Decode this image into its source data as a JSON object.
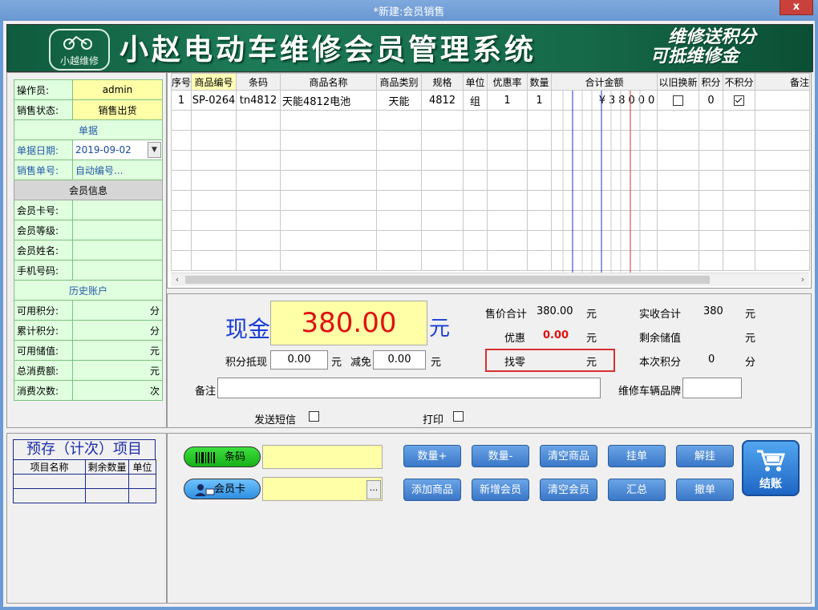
{
  "window": {
    "title": "*新建:会员销售",
    "close_label": "x"
  },
  "banner": {
    "logo_text": "小越维修",
    "brand": "小赵电动车维修会员管理系统",
    "slogan_line1": "维修送积分",
    "slogan_line2": "可抵维修金"
  },
  "info": {
    "operator_label": "操作员:",
    "operator": "admin",
    "sale_status_label": "销售状态:",
    "sale_status": "销售出货",
    "doc_section": "单据",
    "doc_date_label": "单据日期:",
    "doc_date": "2019-09-02",
    "sale_no_label": "销售单号:",
    "sale_no": "自动编号...",
    "member_section": "会员信息",
    "card_label": "会员卡号:",
    "level_label": "会员等级:",
    "name_label": "会员姓名:",
    "phone_label": "手机号码:",
    "history_section": "历史账户",
    "avail_points_label": "可用积分:",
    "avail_points_unit": "分",
    "total_points_label": "累计积分:",
    "total_points_unit": "分",
    "avail_stored_label": "可用储值:",
    "avail_stored_unit": "元",
    "total_spend_label": "总消费额:",
    "total_spend_unit": "元",
    "spend_count_label": "消费次数:",
    "spend_count_unit": "次"
  },
  "grid": {
    "headers": [
      "序号",
      "商品编号",
      "条码",
      "商品名称",
      "商品类别",
      "规格",
      "单位",
      "优惠率",
      "数量",
      "合计金额",
      "以旧换新",
      "积分",
      "不积分",
      "备注"
    ],
    "rows": [
      {
        "no": "1",
        "code": "SP-0264",
        "barcode": "tn4812",
        "name": "天能4812电池",
        "category": "天能",
        "spec": "4812",
        "unit": "组",
        "discount": "1",
        "qty": "1",
        "amount": "¥38000",
        "tradein": false,
        "points": "0",
        "nopoints": true,
        "remark": ""
      }
    ]
  },
  "payment": {
    "cash_label": "现金",
    "cash_amount": "380.00",
    "cash_unit": "元",
    "points_offset_label": "积分抵现",
    "points_offset": "0.00",
    "points_offset_unit": "元",
    "reduce_label": "减免",
    "reduce": "0.00",
    "reduce_unit": "元",
    "price_total_label": "售价合计",
    "price_total": "380.00",
    "price_total_unit": "元",
    "discount_label": "优惠",
    "discount": "0.00",
    "discount_unit": "元",
    "change_label": "找零",
    "change_unit": "元",
    "received_label": "实收合计",
    "received": "380",
    "received_unit": "元",
    "remaining_label": "剩余储值",
    "remaining_unit": "元",
    "this_points_label": "本次积分",
    "this_points": "0",
    "this_points_unit": "分",
    "remark_label": "备注",
    "plate_label": "维修车辆品牌",
    "sms_label": "发送短信",
    "print_label": "打印"
  },
  "prestore": {
    "title": "预存（计次）项目",
    "headers": [
      "项目名称",
      "剩余数量",
      "单位"
    ]
  },
  "actions": {
    "barcode_label": "条码",
    "card_label": "会员卡",
    "more": "...",
    "buttons_row1": [
      "数量+",
      "数量-",
      "清空商品",
      "挂单",
      "解挂"
    ],
    "buttons_row2": [
      "添加商品",
      "新增会员",
      "清空会员",
      "汇总",
      "撤单"
    ],
    "pay_label": "结账"
  },
  "colors": {
    "accent": "#3a77c8",
    "cash_red": "#e01010",
    "banner_green": "#1d7a57"
  }
}
